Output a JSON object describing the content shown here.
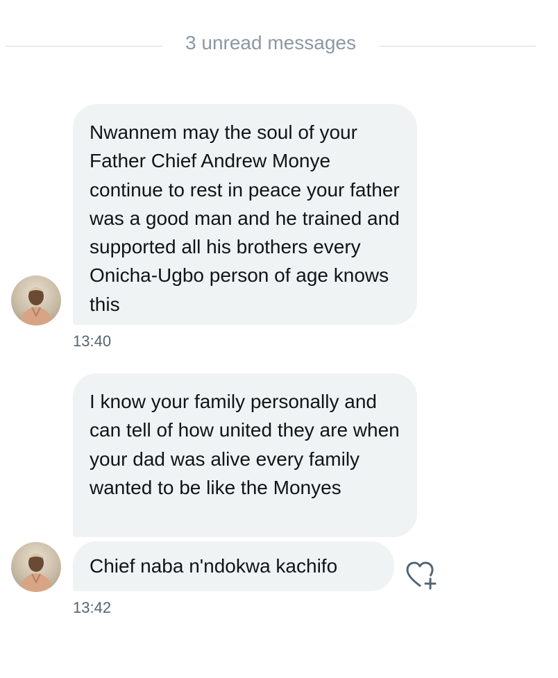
{
  "unread_divider": {
    "label": "3 unread messages"
  },
  "messages": [
    {
      "text": "Nwannem may the soul of your Father Chief Andrew Monye continue to rest in peace your father was a good man and he trained and supported all his brothers every Onicha-Ugbo person of age knows this",
      "time": "13:40"
    },
    {
      "text": "I know your family personally and can tell of how united they are when your dad was alive every family wanted to be like the Monyes"
    },
    {
      "text": "Chief naba n'ndokwa kachifo",
      "time": "13:42"
    }
  ],
  "icons": {
    "avatar": "user-avatar-photo",
    "react": "heart-plus-icon"
  },
  "colors": {
    "bubble_bg": "#eff3f4",
    "timestamp": "#536471",
    "divider_text": "#8b98a5",
    "divider_line": "#cfd9de"
  }
}
